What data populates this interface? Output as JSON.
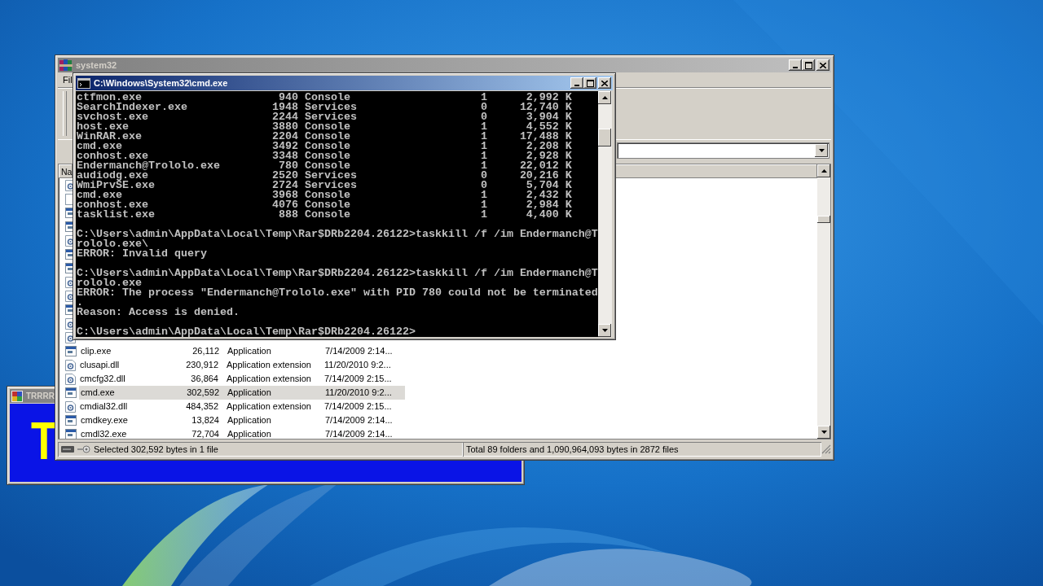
{
  "trrrr_window": {
    "title": "TRRRR",
    "banner": "T"
  },
  "winrar_window": {
    "title": "system32",
    "menu": [
      "Fil"
    ],
    "list_header": [
      "Na"
    ],
    "hidden_rows": [
      {
        "kind": "dll"
      },
      {
        "kind": "blank"
      },
      {
        "kind": "app"
      },
      {
        "kind": "app"
      },
      {
        "kind": "dll"
      },
      {
        "kind": "app"
      },
      {
        "kind": "app"
      },
      {
        "kind": "dll"
      },
      {
        "kind": "dll"
      },
      {
        "kind": "app"
      },
      {
        "kind": "dll"
      },
      {
        "kind": "dll"
      }
    ],
    "files": [
      {
        "kind": "app",
        "name": "clip.exe",
        "size": "26,112",
        "type": "Application",
        "modified": "7/14/2009 2:14...",
        "selected": false
      },
      {
        "kind": "dll",
        "name": "clusapi.dll",
        "size": "230,912",
        "type": "Application extension",
        "modified": "11/20/2010 9:2...",
        "selected": false
      },
      {
        "kind": "dll",
        "name": "cmcfg32.dll",
        "size": "36,864",
        "type": "Application extension",
        "modified": "7/14/2009 2:15...",
        "selected": false
      },
      {
        "kind": "app",
        "name": "cmd.exe",
        "size": "302,592",
        "type": "Application",
        "modified": "11/20/2010 9:2...",
        "selected": true
      },
      {
        "kind": "dll",
        "name": "cmdial32.dll",
        "size": "484,352",
        "type": "Application extension",
        "modified": "7/14/2009 2:15...",
        "selected": false
      },
      {
        "kind": "app",
        "name": "cmdkey.exe",
        "size": "13,824",
        "type": "Application",
        "modified": "7/14/2009 2:14...",
        "selected": false
      },
      {
        "kind": "app",
        "name": "cmdl32.exe",
        "size": "72,704",
        "type": "Application",
        "modified": "7/14/2009 2:14...",
        "selected": false
      }
    ],
    "status_left": "Selected 302,592 bytes in 1 file",
    "status_right": "Total 89 folders and 1,090,964,093 bytes in 2872 files"
  },
  "cmd_window": {
    "title": "C:\\Windows\\System32\\cmd.exe",
    "processes": [
      {
        "name": "ctfmon.exe",
        "pid": "940",
        "session": "Console",
        "session_number": "1",
        "mem": "2,992 K"
      },
      {
        "name": "SearchIndexer.exe",
        "pid": "1948",
        "session": "Services",
        "session_number": "0",
        "mem": "12,740 K"
      },
      {
        "name": "svchost.exe",
        "pid": "2244",
        "session": "Services",
        "session_number": "0",
        "mem": "3,904 K"
      },
      {
        "name": "host.exe",
        "pid": "3880",
        "session": "Console",
        "session_number": "1",
        "mem": "4,552 K"
      },
      {
        "name": "WinRAR.exe",
        "pid": "2204",
        "session": "Console",
        "session_number": "1",
        "mem": "17,488 K"
      },
      {
        "name": "cmd.exe",
        "pid": "3492",
        "session": "Console",
        "session_number": "1",
        "mem": "2,208 K"
      },
      {
        "name": "conhost.exe",
        "pid": "3348",
        "session": "Console",
        "session_number": "1",
        "mem": "2,928 K"
      },
      {
        "name": "Endermanch@Trololo.exe",
        "pid": "780",
        "session": "Console",
        "session_number": "1",
        "mem": "22,012 K"
      },
      {
        "name": "audiodg.exe",
        "pid": "2520",
        "session": "Services",
        "session_number": "0",
        "mem": "20,216 K"
      },
      {
        "name": "WmiPrvSE.exe",
        "pid": "2724",
        "session": "Services",
        "session_number": "0",
        "mem": "5,704 K"
      },
      {
        "name": "cmd.exe",
        "pid": "3968",
        "session": "Console",
        "session_number": "1",
        "mem": "2,432 K"
      },
      {
        "name": "conhost.exe",
        "pid": "4076",
        "session": "Console",
        "session_number": "1",
        "mem": "2,984 K"
      },
      {
        "name": "tasklist.exe",
        "pid": "888",
        "session": "Console",
        "session_number": "1",
        "mem": "4,400 K"
      }
    ],
    "blocks": [
      [
        "C:\\Users\\admin\\AppData\\Local\\Temp\\Rar$DRb2204.26122>taskkill /f /im Endermanch@T",
        "rololo.exe\\",
        "ERROR: Invalid query"
      ],
      [
        "C:\\Users\\admin\\AppData\\Local\\Temp\\Rar$DRb2204.26122>taskkill /f /im Endermanch@T",
        "rololo.exe",
        "ERROR: The process \"Endermanch@Trololo.exe\" with PID 780 could not be terminated",
        ".",
        "Reason: Access is denied."
      ],
      [
        "C:\\Users\\admin\\AppData\\Local\\Temp\\Rar$DRb2204.26122>"
      ]
    ]
  }
}
